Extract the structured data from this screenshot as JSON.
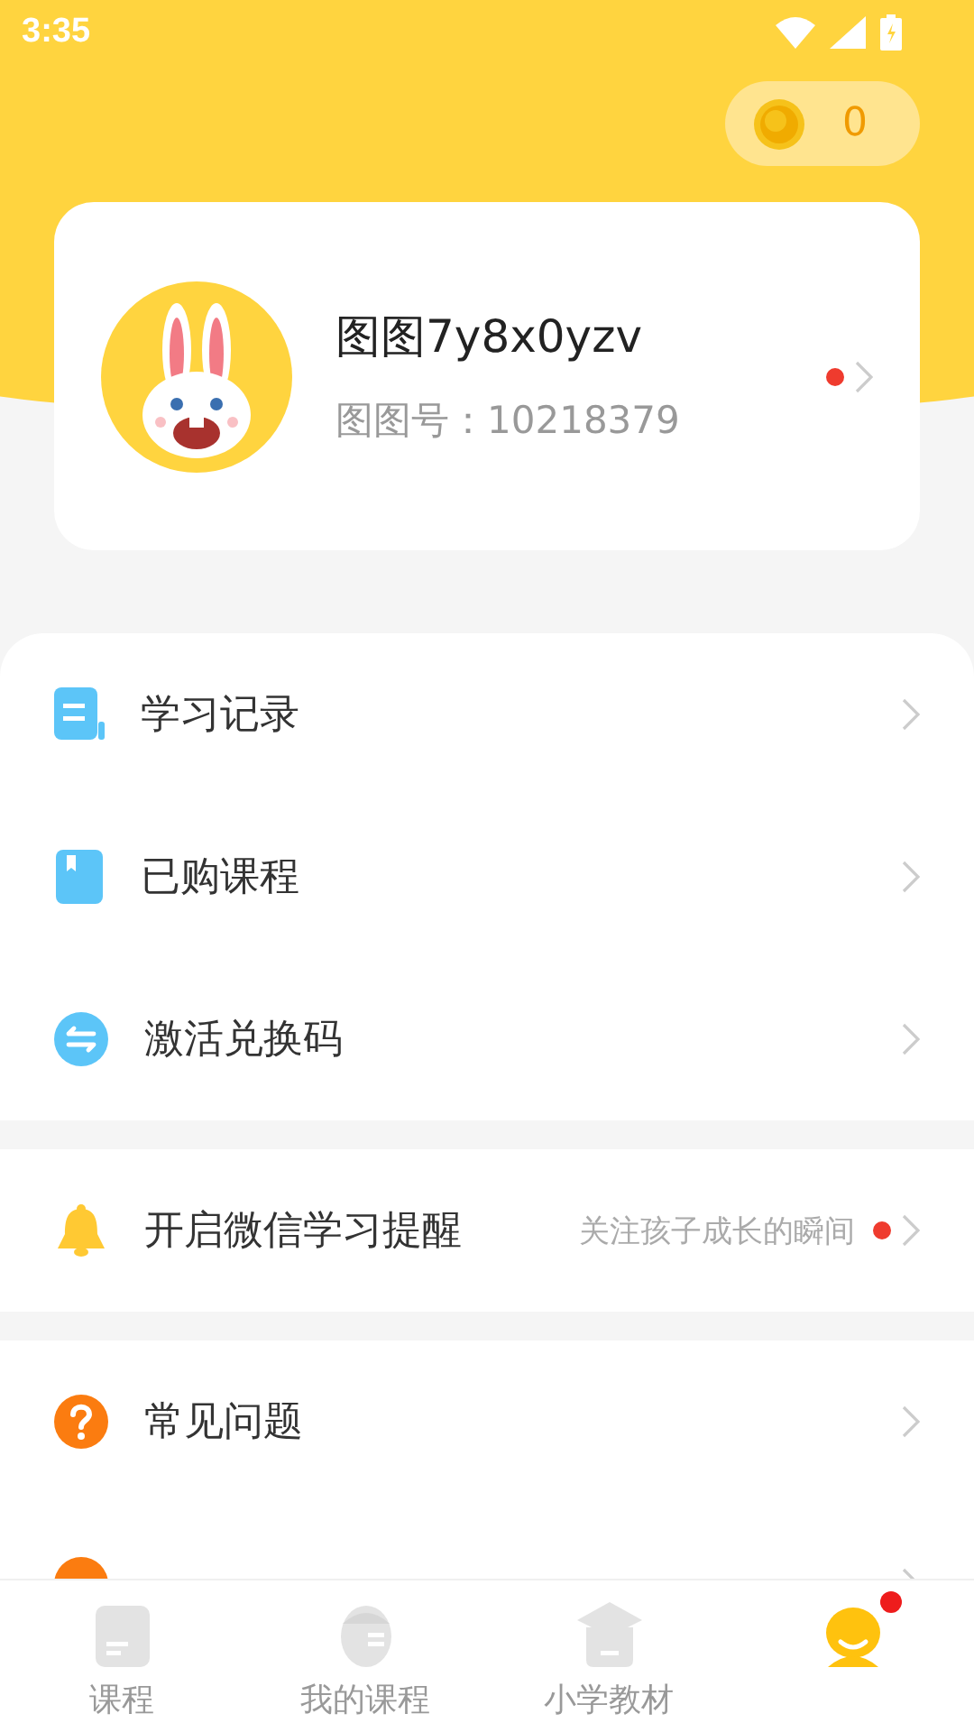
{
  "status_bar": {
    "time": "3:35"
  },
  "coins": {
    "count": "0"
  },
  "profile": {
    "name": "图图7y8x0yzv",
    "id_line": "图图号：10218379",
    "dot": true
  },
  "menu_sections": [
    {
      "items": [
        {
          "label": "学习记录",
          "dot": false
        },
        {
          "label": "已购课程",
          "dot": false
        },
        {
          "label": "激活兑换码",
          "dot": false
        }
      ]
    },
    {
      "items": [
        {
          "label": "开启微信学习提醒",
          "hint": "关注孩子成长的瞬间",
          "dot": true
        }
      ]
    },
    {
      "items": [
        {
          "label": "常见问题",
          "dot": false
        },
        {
          "dot": false
        }
      ]
    }
  ],
  "tabs": [
    {
      "label": "课程",
      "selected": false,
      "dot": false
    },
    {
      "label": "我的课程",
      "selected": false,
      "dot": false
    },
    {
      "label": "小学教材",
      "selected": false,
      "dot": false
    },
    {
      "selected": true,
      "dot": true
    }
  ]
}
